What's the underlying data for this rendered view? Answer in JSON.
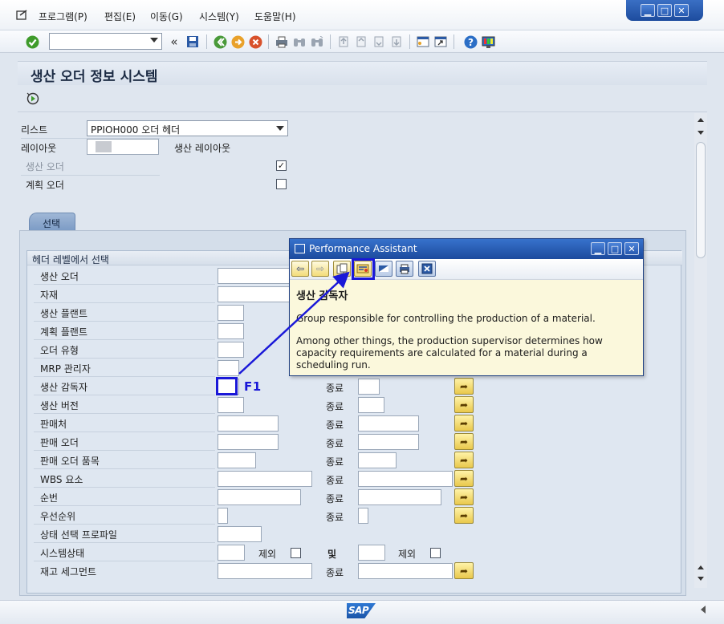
{
  "menu": {
    "items": [
      "프로그램(P)",
      "편집(E)",
      "이동(G)",
      "시스템(Y)",
      "도움말(H)"
    ]
  },
  "page": {
    "title": "생산 오더 정보 시스템"
  },
  "form": {
    "list_label": "리스트",
    "list_value": "PPIOH000 오더 헤더",
    "layout_label": "레이아웃",
    "layout_desc": "생산 레이아웃",
    "prod_order_label": "생산 오더",
    "prod_order_checked": true,
    "plan_order_label": "계획 오더",
    "plan_order_checked": false
  },
  "tab": {
    "label": "선택"
  },
  "group": {
    "title": "헤더 레벨에서 선택",
    "rows": [
      {
        "label": "생산 오더"
      },
      {
        "label": "자재"
      },
      {
        "label": "생산 플랜트"
      },
      {
        "label": "계획 플랜트"
      },
      {
        "label": "오더 유형"
      },
      {
        "label": "MRP 관리자"
      },
      {
        "label": "생산 감독자",
        "to_label": "종료"
      },
      {
        "label": "생산 버전",
        "to_label": "종료"
      },
      {
        "label": "판매처",
        "to_label": "종료"
      },
      {
        "label": "판매 오더",
        "to_label": "종료"
      },
      {
        "label": "판매 오더 품목",
        "to_label": "종료"
      },
      {
        "label": "WBS 요소",
        "to_label": "종료"
      },
      {
        "label": "순번",
        "to_label": "종료"
      },
      {
        "label": "우선순위",
        "to_label": "종료"
      },
      {
        "label": "상태 선택 프로파일"
      },
      {
        "label": "시스템상태",
        "excl_label": "제외",
        "and_label": "및",
        "excl2_label": "제외"
      },
      {
        "label": "재고 세그먼트",
        "to_label": "종료"
      }
    ]
  },
  "annotation": {
    "f1": "F1",
    "color": "#1a18d8"
  },
  "popup": {
    "title": "Performance Assistant",
    "heading": "생산 감독자",
    "text1": "Group responsible for controlling the production of a material.",
    "text2": "Among other things, the production supervisor determines how capacity requirements are calculated for a material during a scheduling run."
  },
  "status": {
    "logo": "SAP"
  }
}
